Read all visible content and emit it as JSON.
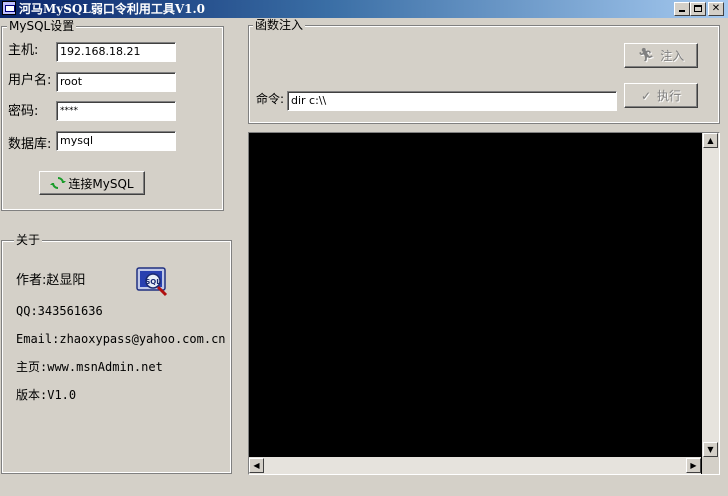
{
  "window": {
    "title": "河马MySQL弱口令利用工具V1.0",
    "min_icon": "minimize-icon",
    "max_icon": "maximize-icon",
    "close_icon": "close-icon"
  },
  "mysql": {
    "group_title": "MySQL设置",
    "host_label": "主机:",
    "host_value": "192.168.18.21",
    "user_label": "用户名:",
    "user_value": "root",
    "password_label": "密码:",
    "password_value": "****",
    "db_label": "数据库:",
    "db_value": "mysql",
    "connect_label": "连接MySQL"
  },
  "inject": {
    "group_title": "函数注入",
    "inject_label": "注入",
    "command_label": "命令:",
    "command_value": "dir c:\\\\",
    "execute_label": "执行"
  },
  "about": {
    "group_title": "关于",
    "author": "作者:赵显阳",
    "qq": "QQ:343561636",
    "email": "Email:zhaoxypass@yahoo.com.cn",
    "homepage": "主页:www.msnAdmin.net",
    "version": "版本:V1.0",
    "logo_text": "SQL"
  },
  "colors": {
    "title_start": "#0a246a",
    "title_end": "#a6caf0",
    "output_bg": "#000000",
    "face": "#d4d0c8"
  }
}
